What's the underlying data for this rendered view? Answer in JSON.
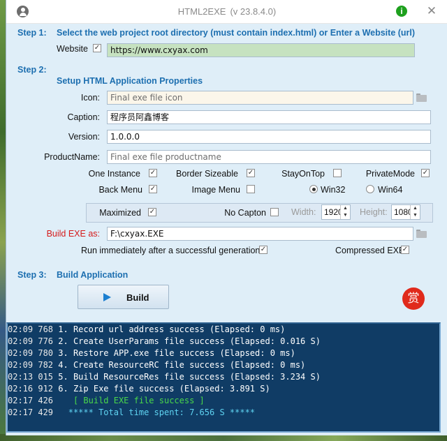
{
  "window": {
    "title": "HTML2EXE",
    "version": "(v 23.8.4.0)"
  },
  "step1": {
    "heading": "Step 1:",
    "description": "Select the web project root directory (must contain index.html) or Enter a Website (url)",
    "website_label": "Website",
    "website_checked": true,
    "url_value": "https://www.cxyax.com"
  },
  "step2": {
    "heading": "Step 2:",
    "subheading": "Setup HTML Application Properties",
    "icon_label": "Icon:",
    "icon_placeholder": "Final exe file icon",
    "caption_label": "Caption:",
    "caption_value": "程序员阿鑫博客",
    "version_label": "Version:",
    "version_value": "1.0.0.0",
    "productname_label": "ProductName:",
    "productname_placeholder": "Final exe file productname",
    "options": {
      "one_instance": {
        "label": "One Instance",
        "checked": true
      },
      "border_sizeable": {
        "label": "Border Sizeable",
        "checked": true
      },
      "stay_on_top": {
        "label": "StayOnTop",
        "checked": false
      },
      "private_mode": {
        "label": "PrivateMode",
        "checked": true
      },
      "back_menu": {
        "label": "Back Menu",
        "checked": true
      },
      "image_menu": {
        "label": "Image Menu",
        "checked": false
      },
      "win32": {
        "label": "Win32",
        "selected": true
      },
      "win64": {
        "label": "Win64",
        "selected": false
      }
    },
    "window_opts": {
      "maximized": {
        "label": "Maximized",
        "checked": true
      },
      "no_capton": {
        "label": "No Capton",
        "checked": false
      },
      "width_label": "Width:",
      "width_value": "1920",
      "height_label": "Height:",
      "height_value": "1080"
    },
    "build_exe_label": "Build EXE as:",
    "build_exe_value": "F:\\cxyax.EXE",
    "run_after": {
      "label": "Run immediately after a successful generation",
      "checked": true
    },
    "compressed": {
      "label": "Compressed EXE",
      "checked": true
    }
  },
  "step3": {
    "heading": "Step 3:",
    "subheading": "Build Application",
    "build_label": "Build",
    "reward_glyph": "赏"
  },
  "log": [
    {
      "time": "02:09 768",
      "msg": "1. Record url address success (Elapsed: 0 ms)",
      "style": "white"
    },
    {
      "time": "02:09 776",
      "msg": "2. Create UserParams file success (Elapsed: 0.016 S)",
      "style": "white"
    },
    {
      "time": "02:09 780",
      "msg": "3. Restore APP.exe file success (Elapsed: 0 ms)",
      "style": "white"
    },
    {
      "time": "02:09 782",
      "msg": "4. Create ResourceRC file success (Elapsed: 0 ms)",
      "style": "white"
    },
    {
      "time": "02:13 015",
      "msg": "5. Build ResourceRes file success (Elapsed: 3.234 S)",
      "style": "white"
    },
    {
      "time": "02:16 912",
      "msg": "6. Zip Exe file success (Elapsed: 3.891 S)",
      "style": "white"
    },
    {
      "time": "02:17 426",
      "msg": "   [ Build EXE file success ]",
      "style": "green"
    },
    {
      "time": "02:17 429",
      "msg": "  ***** Total time spent: 7.656 S *****",
      "style": "cyan"
    }
  ]
}
